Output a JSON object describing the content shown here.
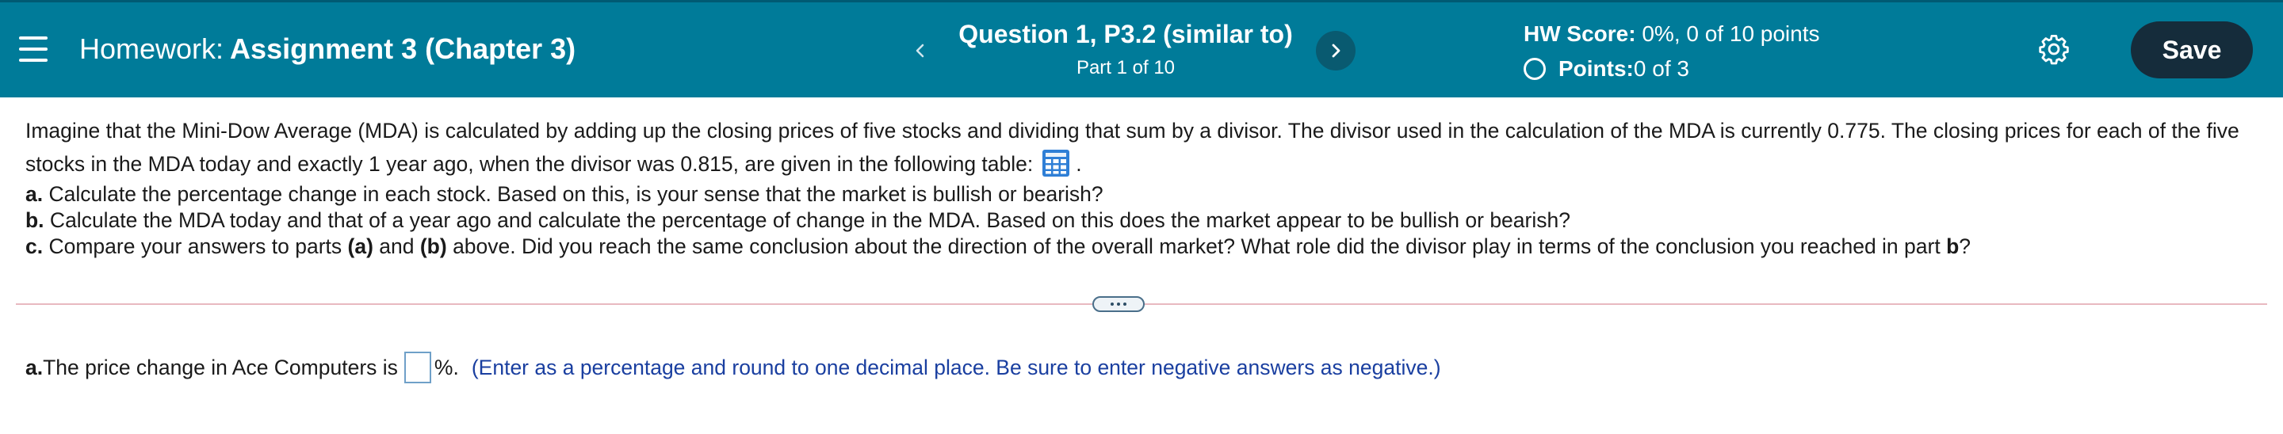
{
  "header": {
    "homework_prefix": "Homework:",
    "assignment_name": "Assignment 3 (Chapter 3)",
    "question_title": "Question 1, P3.2 (similar to)",
    "question_part": "Part 1 of 10",
    "hw_score_label": "HW Score:",
    "hw_score_value": " 0%, 0 of 10 points",
    "points_label": "Points:",
    "points_value": " 0 of 3",
    "save_label": "Save",
    "colors": {
      "bar": "#007b99",
      "save_button": "#152c3b",
      "next_button": "#095a70"
    }
  },
  "question": {
    "intro": "Imagine that the Mini-Dow Average (MDA) is calculated by adding up the closing prices of five stocks and dividing that sum by a divisor. The divisor used in the calculation of the MDA is currently 0.775. The closing prices for each of the five stocks in the MDA today and exactly 1 year ago, when the divisor was 0.815, are given in the following table:",
    "intro_end": ".",
    "part_a_label": "a.",
    "part_a_text": " Calculate the percentage change in each stock. Based on this, is your sense that the market is bullish or bearish?",
    "part_b_label": "b.",
    "part_b_text": " Calculate the MDA today and that of a year ago and calculate the percentage of change in the MDA. Based on this does the market appear to be bullish or bearish?",
    "part_c_label": "c.",
    "part_c_text_1": " Compare your answers to parts ",
    "part_c_ref_a": "(a)",
    "part_c_text_2": " and ",
    "part_c_ref_b": "(b)",
    "part_c_text_3": " above. Did you reach the same conclusion about the direction of the overall market? What role did the divisor play in terms of the conclusion you reached in part ",
    "part_c_ref_b2": "b",
    "part_c_text_4": "?"
  },
  "answer": {
    "label": "a.",
    "prompt": " The price change in Ace Computers is",
    "input_value": "",
    "suffix": "%.",
    "instruction": "(Enter as a percentage and round to one decimal place. Be sure to enter negative answers as negative.)"
  },
  "icons": [
    "menu-icon",
    "chevron-left-icon",
    "chevron-right-icon",
    "gear-icon",
    "table-icon",
    "ellipsis-icon",
    "radio-circle-icon"
  ]
}
